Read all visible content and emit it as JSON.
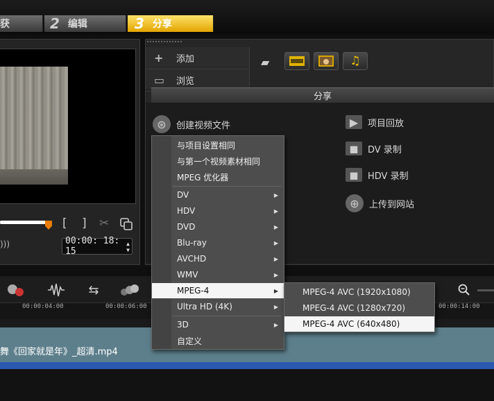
{
  "steps": [
    {
      "num": "",
      "label": "获"
    },
    {
      "num": "2",
      "label": "编辑"
    },
    {
      "num": "3",
      "label": "分享"
    }
  ],
  "preview": {
    "timecode": "00:00: 18: 15",
    "mark_in": "[",
    "mark_out": "]"
  },
  "library": {
    "add_label": "添加",
    "browse_label": "浏览"
  },
  "share": {
    "header": "分享",
    "create_video": "创建视频文件",
    "project_playback": "项目回放",
    "dv_record": "DV 录制",
    "hdv_record": "HDV 录制",
    "upload_web": "上传到网站"
  },
  "menu": {
    "items": [
      {
        "label": "与项目设置相同"
      },
      {
        "label": "与第一个视频素材相同"
      },
      {
        "label": "MPEG 优化器"
      },
      {
        "label": "DV"
      },
      {
        "label": "HDV"
      },
      {
        "label": "DVD"
      },
      {
        "label": "Blu-ray"
      },
      {
        "label": "AVCHD"
      },
      {
        "label": "WMV"
      },
      {
        "label": "MPEG-4"
      },
      {
        "label": "Ultra HD (4K)"
      },
      {
        "label": "3D"
      },
      {
        "label": "自定义"
      }
    ]
  },
  "submenu": {
    "items": [
      {
        "label": "MPEG-4 AVC (1920x1080)"
      },
      {
        "label": "MPEG-4 AVC (1280x720)"
      },
      {
        "label": "MPEG-4 AVC (640x480)"
      }
    ]
  },
  "timeline": {
    "ticks": [
      "00:00:04:00",
      "00:00:06:00",
      "00:00:14:00"
    ],
    "clip_title": "舞《回家就是年》_超清.mp4"
  },
  "colors": {
    "accent": "#f0b400",
    "highlight": "#f5f5f5",
    "clip": "#5d7f8c",
    "timeline_blue": "#2b58b0"
  }
}
